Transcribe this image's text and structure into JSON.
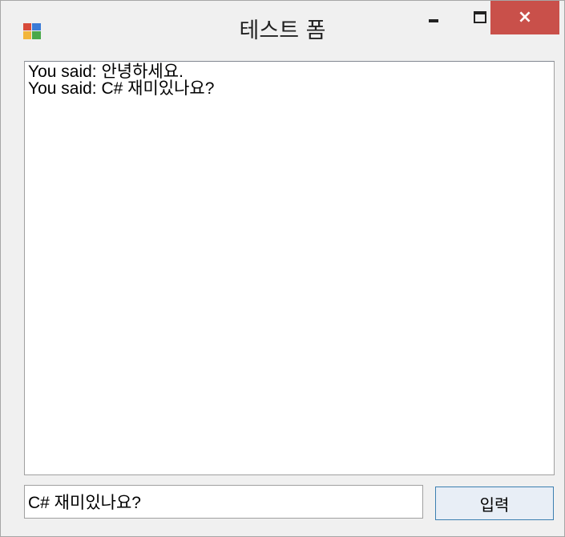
{
  "window": {
    "title": "테스트 폼",
    "controls": {
      "minimize_icon": "minimize-icon",
      "maximize_icon": "maximize-icon",
      "close_symbol": "×"
    },
    "accent_close_color": "#c9504a"
  },
  "output": {
    "lines": [
      "You said: 안녕하세요.",
      "You said: C# 재미있나요?"
    ]
  },
  "input": {
    "value": "C# 재미있나요?"
  },
  "submit": {
    "label": "입력"
  }
}
